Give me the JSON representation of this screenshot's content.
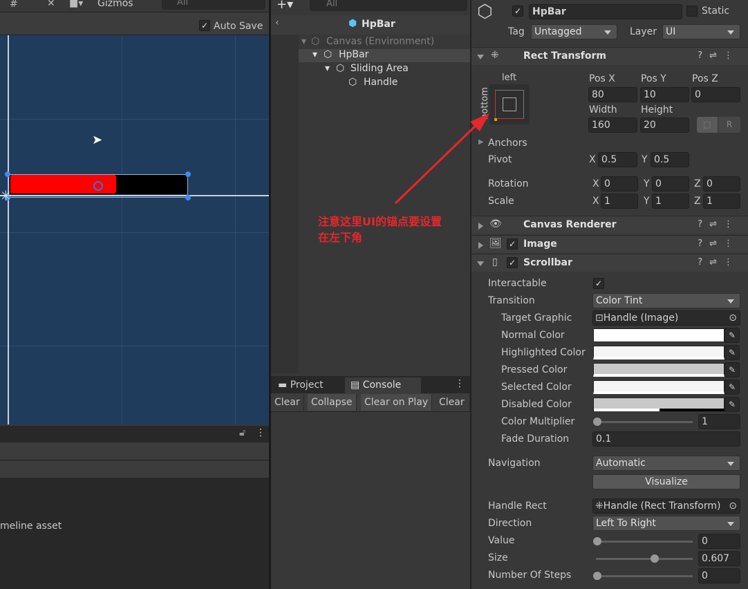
{
  "scene": {
    "toolbar": {
      "gizmos": "Gizmos",
      "search_placeholder": "All"
    },
    "auto_save": "Auto Save",
    "auto_save_checked": true,
    "bottom_text": "meline asset",
    "bar_fill_color": "#ff0000",
    "bar_bg_color": "#000000"
  },
  "hierarchy": {
    "search_placeholder": "All",
    "title": "HpBar",
    "items": [
      {
        "label": "Canvas (Environment)"
      },
      {
        "label": "HpBar"
      },
      {
        "label": "Sliding Area"
      },
      {
        "label": "Handle"
      }
    ]
  },
  "console": {
    "tabs": [
      "Project",
      "Console"
    ],
    "buttons": [
      "Clear",
      "Collapse",
      "Clear on Play",
      "Clear on Build"
    ]
  },
  "annotation": {
    "text_line1": "注意这里UI的锚点要设置",
    "text_line2": "在左下角",
    "color": "#e8262b"
  },
  "inspector": {
    "object": {
      "name": "HpBar",
      "active": true,
      "static_label": "Static",
      "tag_label": "Tag",
      "tag": "Untagged",
      "layer_label": "Layer",
      "layer": "UI"
    },
    "rect_transform": {
      "title": "Rect Transform",
      "anchor_h": "left",
      "anchor_v": "bottom",
      "pos_x_label": "Pos X",
      "pos_x": "80",
      "pos_y_label": "Pos Y",
      "pos_y": "10",
      "pos_z_label": "Pos Z",
      "pos_z": "0",
      "width_label": "Width",
      "width": "160",
      "height_label": "Height",
      "height": "20",
      "anchors_label": "Anchors",
      "pivot_label": "Pivot",
      "pivot_x": "0.5",
      "pivot_y": "0.5",
      "rotation_label": "Rotation",
      "rot": [
        "0",
        "0",
        "0"
      ],
      "scale_label": "Scale",
      "scale": [
        "1",
        "1",
        "1"
      ],
      "x": "X",
      "y": "Y",
      "z": "Z"
    },
    "canvas_renderer": {
      "title": "Canvas Renderer"
    },
    "image": {
      "title": "Image",
      "enabled": true
    },
    "scrollbar": {
      "title": "Scrollbar",
      "enabled": true,
      "rows": {
        "interactable": "Interactable",
        "transition": "Transition",
        "transition_value": "Color Tint",
        "target_graphic": "Target Graphic",
        "target_graphic_value": "Handle (Image)",
        "normal": "Normal Color",
        "highlighted": "Highlighted Color",
        "pressed": "Pressed Color",
        "selected": "Selected Color",
        "disabled": "Disabled Color",
        "multiplier": "Color Multiplier",
        "multiplier_value": "1",
        "fade": "Fade Duration",
        "fade_value": "0.1",
        "navigation": "Navigation",
        "navigation_value": "Automatic",
        "visualize": "Visualize",
        "handle_rect": "Handle Rect",
        "handle_rect_value": "Handle (Rect Transform)",
        "direction": "Direction",
        "direction_value": "Left To Right",
        "value": "Value",
        "value_value": "0",
        "size": "Size",
        "size_value": "0.607",
        "steps": "Number Of Steps",
        "steps_value": "0"
      },
      "colors": {
        "normal": "#ffffff",
        "highlighted": "#f5f5f5",
        "pressed": "#c8c8c8",
        "selected": "#f5f5f5",
        "disabled": "#c8c8c8"
      },
      "interactable": true
    }
  }
}
